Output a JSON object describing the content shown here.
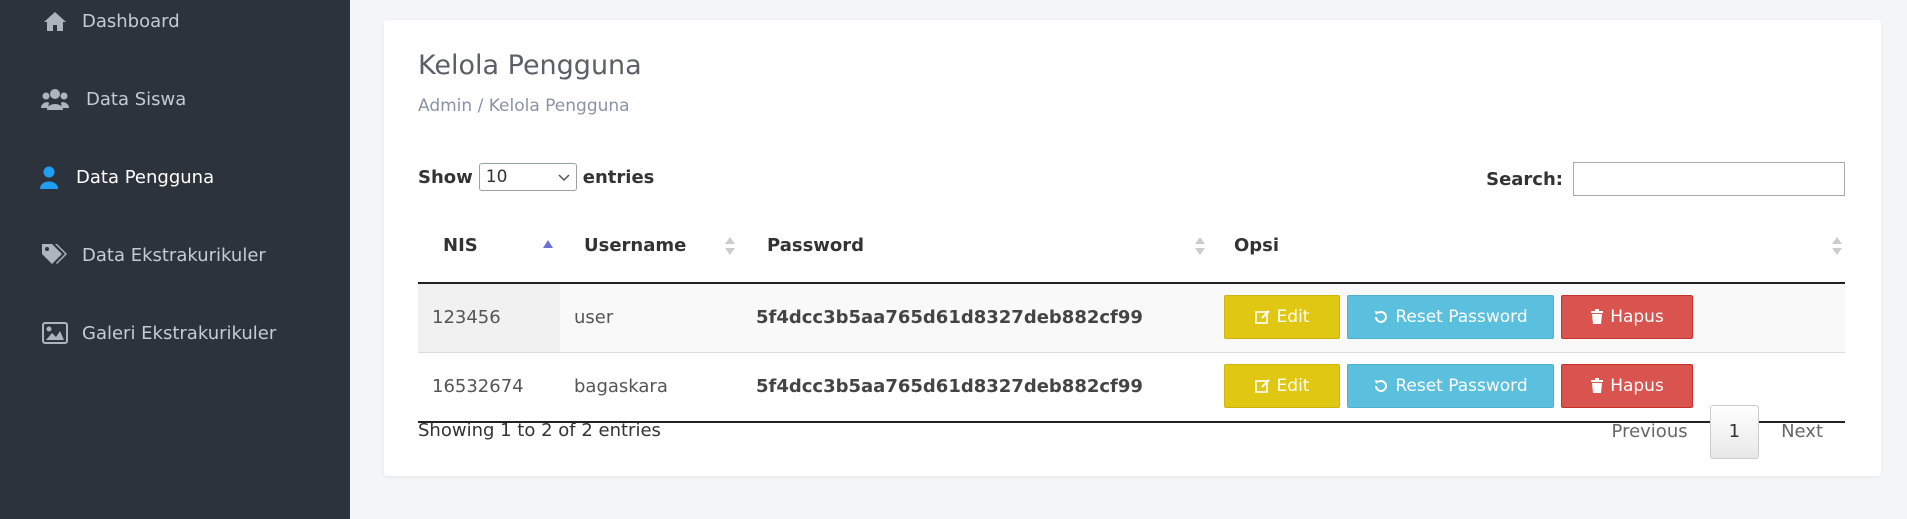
{
  "sidebar": {
    "items": [
      {
        "label": "Dashboard",
        "icon": "home-icon"
      },
      {
        "label": "Data Siswa",
        "icon": "users-icon"
      },
      {
        "label": "Data Pengguna",
        "icon": "user-icon"
      },
      {
        "label": "Data Ekstrakurikuler",
        "icon": "tags-icon"
      },
      {
        "label": "Galeri Ekstrakurikuler",
        "icon": "image-icon"
      }
    ]
  },
  "header": {
    "title": "Kelola Pengguna",
    "breadcrumb": "Admin / Kelola Pengguna"
  },
  "table_controls": {
    "show_label": "Show",
    "entries_value": "10",
    "entries_label": "entries",
    "search_label": "Search:",
    "search_value": ""
  },
  "table": {
    "columns": [
      "NIS",
      "Username",
      "Password",
      "Opsi"
    ],
    "rows": [
      {
        "nis": "123456",
        "username": "user",
        "password": "5f4dcc3b5aa765d61d8327deb882cf99"
      },
      {
        "nis": "16532674",
        "username": "bagaskara",
        "password": "5f4dcc3b5aa765d61d8327deb882cf99"
      }
    ],
    "actions": {
      "edit": "Edit",
      "reset": "Reset Password",
      "delete": "Hapus"
    }
  },
  "footer": {
    "info": "Showing 1 to 2 of 2 entries",
    "previous": "Previous",
    "current_page": "1",
    "next": "Next"
  },
  "colors": {
    "sidebar_bg": "#2c333d",
    "active_icon": "#1e9ff2",
    "edit": "#e0c711",
    "reset": "#5bc0de",
    "delete": "#d9534f"
  }
}
